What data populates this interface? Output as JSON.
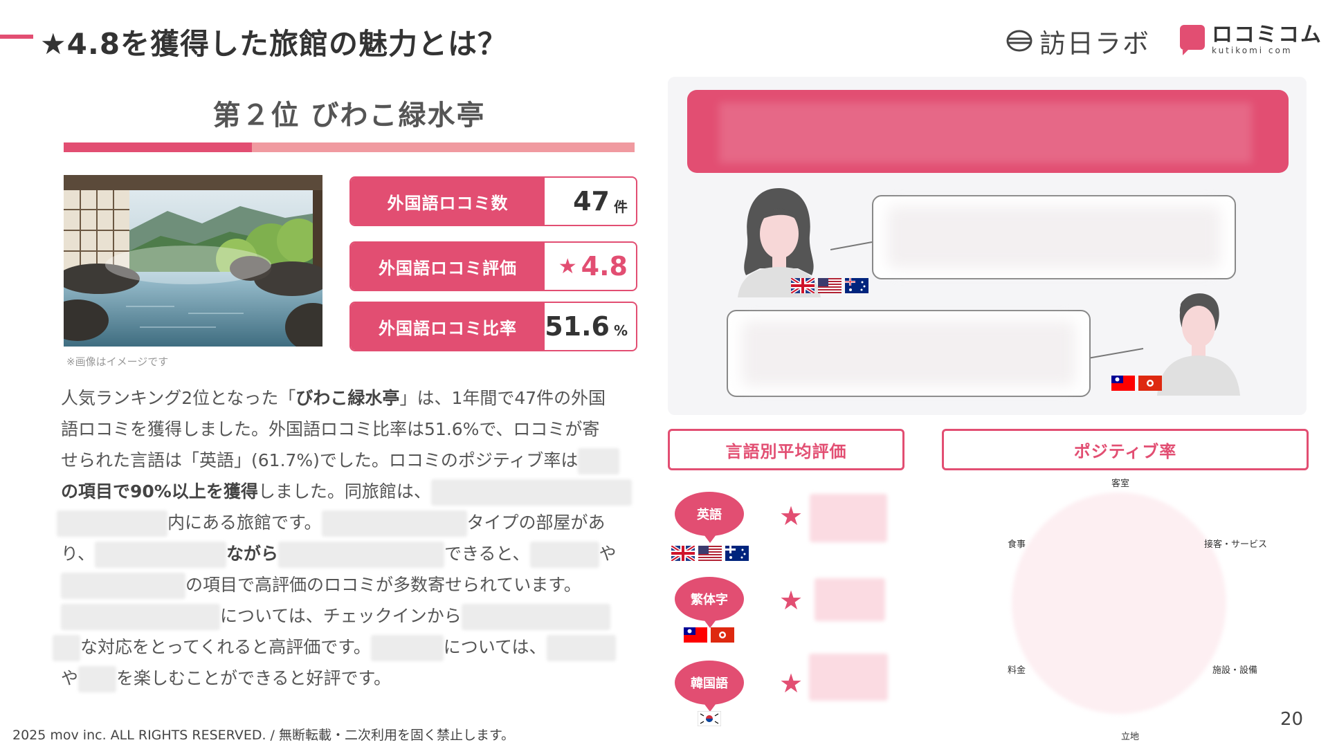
{
  "header": {
    "title": "★4.8を獲得した旅館の魅力とは？",
    "logo_inbound": "訪日ラボ",
    "logo_kutikomi": "ロコミコム",
    "logo_kutikomi_sub": "kutikomi com"
  },
  "rank": {
    "title": "第２位  びわこ緑水亭",
    "image_caption": "※画像はイメージです"
  },
  "stats": [
    {
      "label": "外国語ロコミ数",
      "value": "47",
      "unit": "件"
    },
    {
      "label": "外国語ロコミ評価",
      "value": "4.8",
      "star": "★"
    },
    {
      "label": "外国語ロコミ比率",
      "value": "51.6",
      "unit": "%"
    }
  ],
  "body": {
    "l1a": "人気ランキング2位となった「",
    "l1b": "びわこ緑水亭",
    "l1c": "」は、1年間で47件の外国",
    "l2": "語ロコミを獲得しました。外国語ロコミ比率は51.6%で、ロコミが寄",
    "l3": "せられた言語は「英語」(61.7%)でした。ロコミのポジティブ率は",
    "l4a": "の項目で90%以上を獲得",
    "l4b": "しました。同旅館は、",
    "l5a": "内にある旅館です。",
    "l5b": "タイプの部屋があ",
    "l6a": "り、",
    "l6b": "ながら",
    "l6c": "できると、",
    "l6d": "や",
    "l7": "の項目で高評価のロコミが多数寄せられています。",
    "l8": "については、チェックインから",
    "l9a": "な対応をとってくれると高評価です。",
    "l9b": "については、",
    "l10a": "や",
    "l10b": "を楽しむことができると好評です。"
  },
  "footer": {
    "copyright": "2025 mov inc. ALL RIGHTS RESERVED. / 無断転載・二次利用を固く禁止します。",
    "page": "20"
  },
  "right": {
    "avg_rating_label": "言語別平均評価",
    "positive_rate_label": "ポジティブ率",
    "languages": [
      {
        "name": "英語",
        "flags": [
          "uk-flag",
          "us-flag",
          "au-flag"
        ]
      },
      {
        "name": "繁体字",
        "flags": [
          "tw-flag",
          "hk-flag"
        ]
      },
      {
        "name": "韓国語",
        "flags": [
          "kr-flag"
        ]
      }
    ],
    "star": "★",
    "radar_labels": {
      "top": "客室",
      "upper_right": "接客・サービス",
      "lower_right": "施設・設備",
      "bottom": "立地",
      "lower_left": "料金",
      "upper_left": "食事"
    }
  },
  "colors": {
    "accent": "#e24e72",
    "accent_light": "#f09aa0"
  }
}
